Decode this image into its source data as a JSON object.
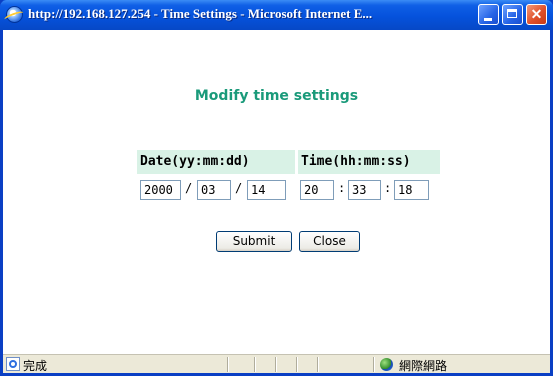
{
  "window": {
    "title": "http://192.168.127.254 - Time Settings - Microsoft Internet E..."
  },
  "page": {
    "title": "Modify time settings",
    "date_header": "Date(yy:mm:dd)",
    "time_header": "Time(hh:mm:ss)",
    "date": {
      "year": "2000",
      "month": "03",
      "day": "14"
    },
    "time": {
      "hour": "20",
      "minute": "33",
      "second": "18"
    },
    "date_separator": "/",
    "time_separator": ":",
    "submit_label": "Submit",
    "close_label": "Close"
  },
  "statusbar": {
    "status": "完成",
    "zone": "網際網路"
  },
  "colors": {
    "accent": "#1a9a7a",
    "header_bg": "#d9f2e6",
    "titlebar": "#0552dc"
  }
}
